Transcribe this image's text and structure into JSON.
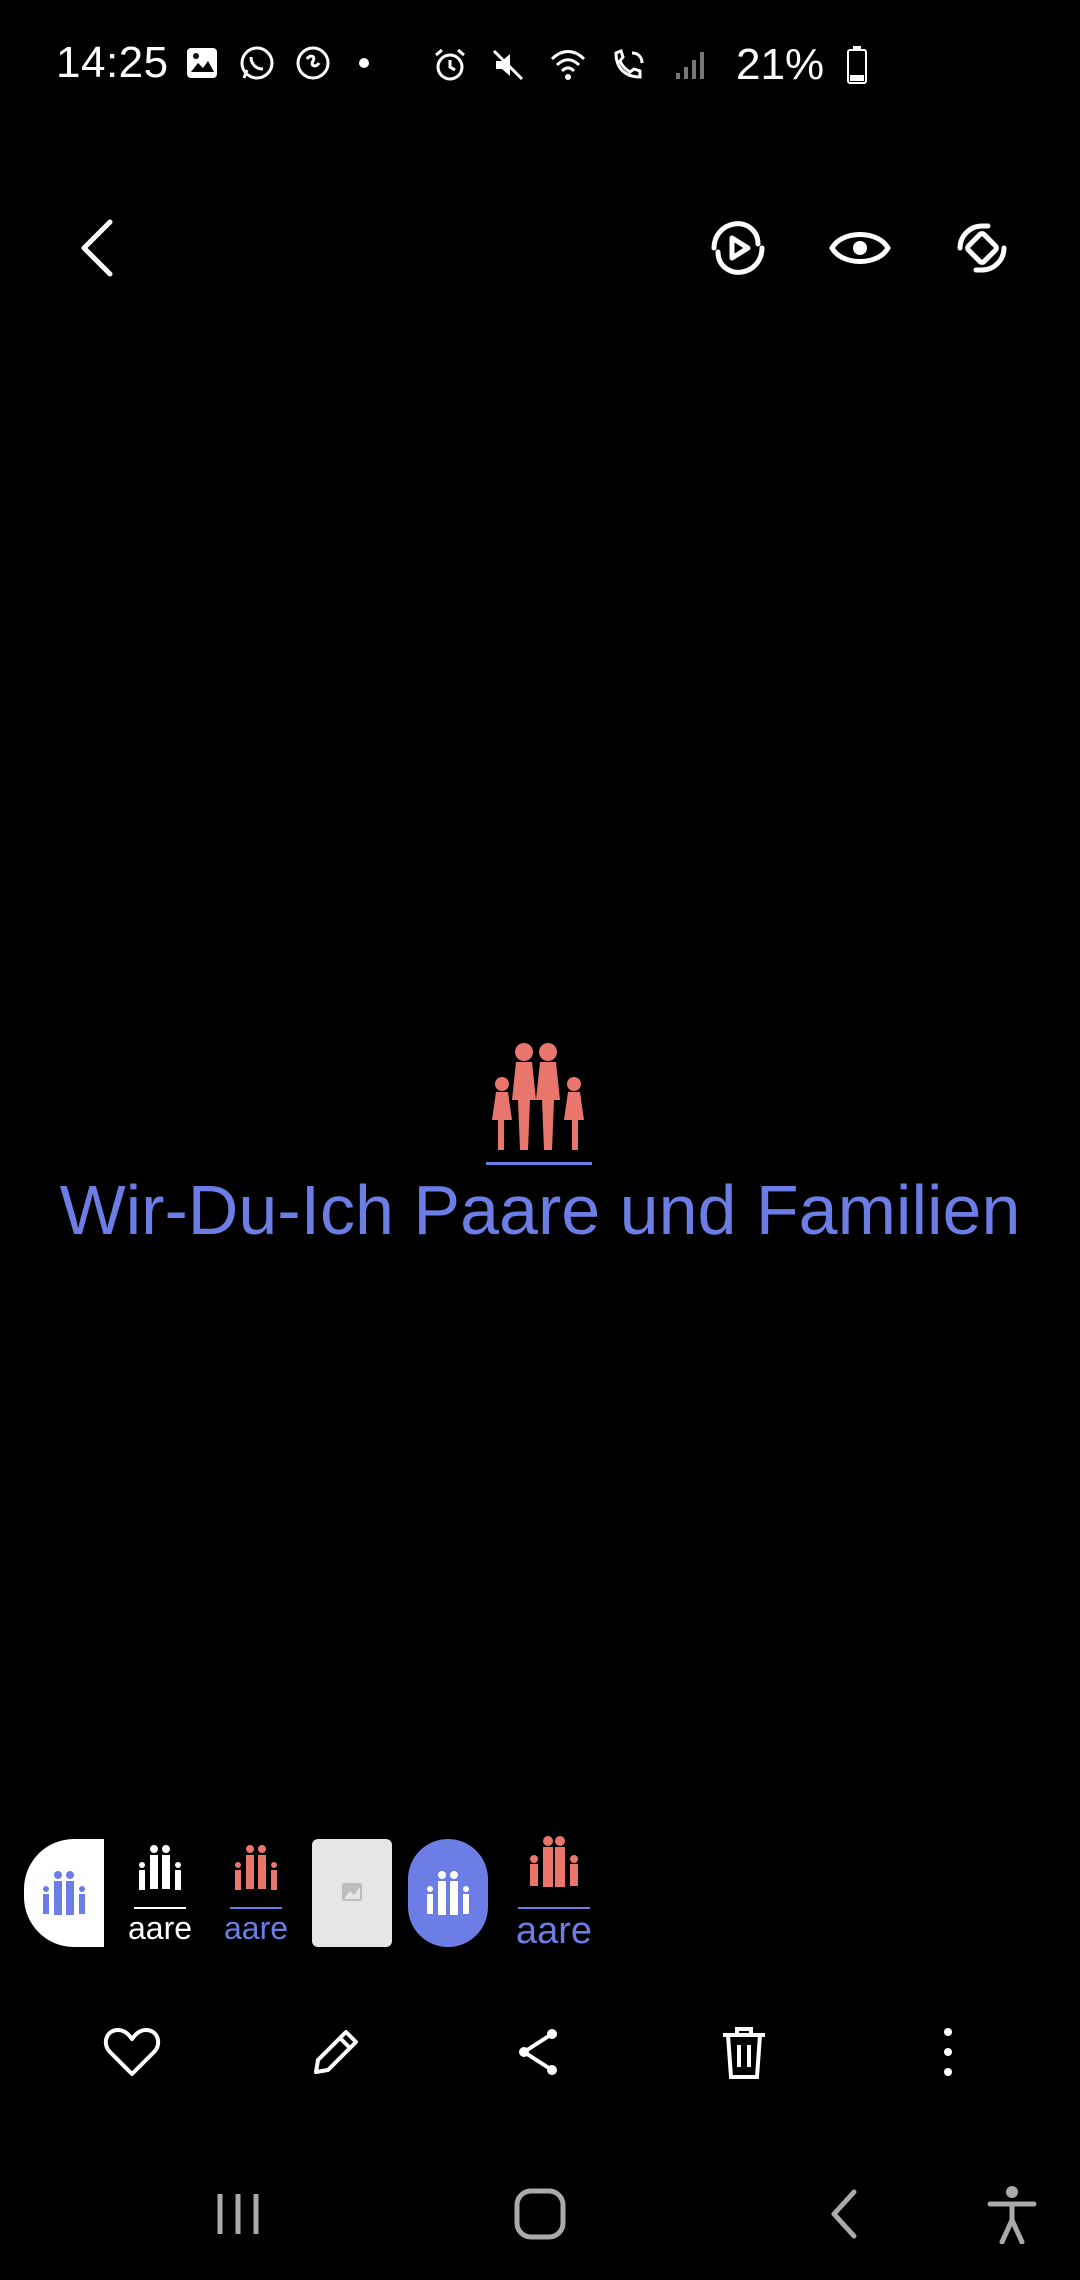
{
  "status_bar": {
    "time": "14:25",
    "battery_percent": "21%",
    "left_icons": [
      "gallery-icon",
      "whatsapp-icon",
      "shazam-icon",
      "dot-icon"
    ],
    "right_icons": [
      "alarm-icon",
      "mute-icon",
      "wifi-icon",
      "wifi-call-icon",
      "signal-icon",
      "battery-icon"
    ]
  },
  "top_bar": {
    "back_icon": "chevron-left-icon",
    "actions": [
      "motion-photo-icon",
      "eye-icon",
      "rotate-icon"
    ]
  },
  "viewer": {
    "logo_text": "Wir-Du-Ich Paare und Familien",
    "accent_color": "#6c7ee6",
    "logo_color": "#e8766c"
  },
  "filmstrip": {
    "thumbs": [
      {
        "type": "family-blue-on-white",
        "label": ""
      },
      {
        "type": "family-white",
        "label": "aare"
      },
      {
        "type": "family-red",
        "label": "aare"
      },
      {
        "type": "placeholder-image",
        "label": ""
      },
      {
        "type": "family-white-on-blue",
        "label": ""
      },
      {
        "type": "family-red-selected",
        "label": "aare"
      }
    ]
  },
  "action_bar": {
    "items": [
      "heart-icon",
      "pencil-icon",
      "share-icon",
      "trash-icon",
      "more-vertical-icon"
    ]
  },
  "nav_bar": {
    "items": [
      "recents-icon",
      "home-icon",
      "back-icon",
      "accessibility-icon"
    ]
  }
}
